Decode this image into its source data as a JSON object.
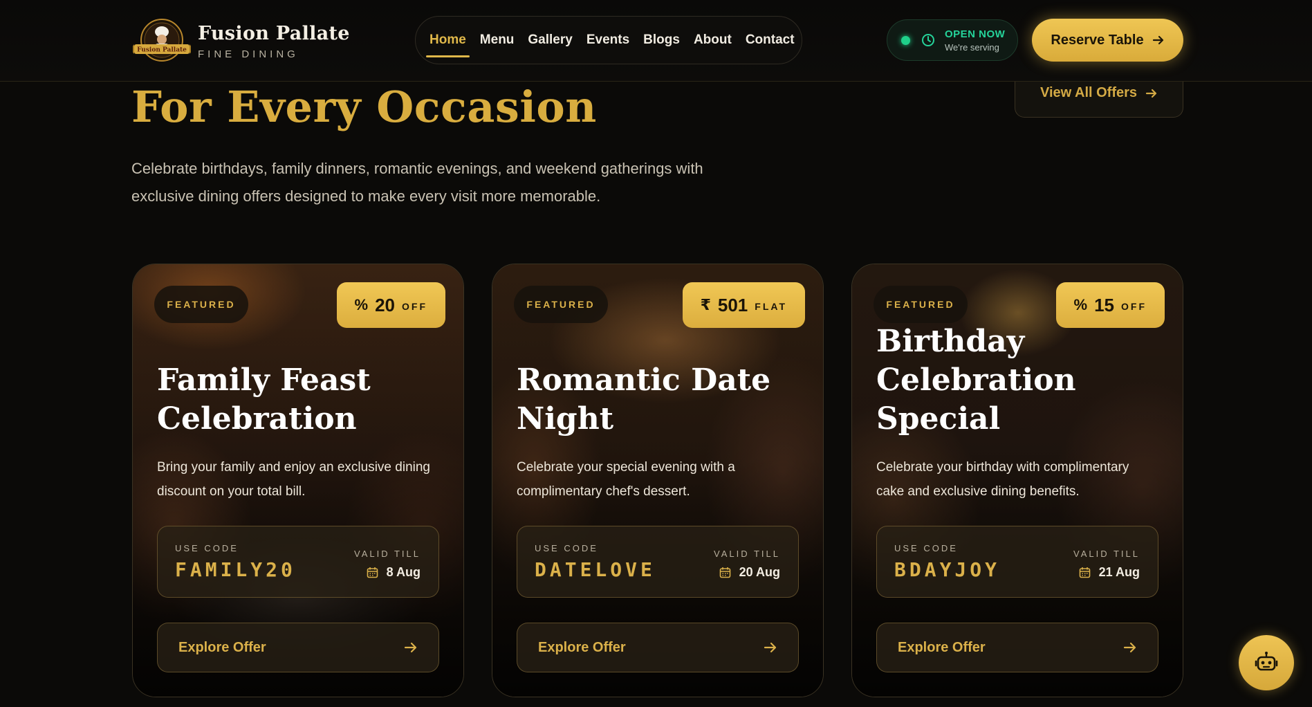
{
  "brand": {
    "name": "Fusion Pallate",
    "subtitle": "FINE DINING",
    "logo_text": "Fusion Pallate"
  },
  "nav": {
    "items": [
      {
        "label": "Home",
        "active": true
      },
      {
        "label": "Menu",
        "active": false
      },
      {
        "label": "Gallery",
        "active": false
      },
      {
        "label": "Events",
        "active": false
      },
      {
        "label": "Blogs",
        "active": false
      },
      {
        "label": "About",
        "active": false
      },
      {
        "label": "Contact",
        "active": false
      }
    ]
  },
  "status": {
    "title": "OPEN NOW",
    "subtitle": "We're serving",
    "dot_color": "#1fd08a",
    "icons": [
      "status-dot",
      "clock-icon"
    ]
  },
  "header": {
    "reserve_label": "Reserve Table",
    "reserve_icon": "arrow-right-icon"
  },
  "section": {
    "title": "For Every Occasion",
    "description": "Celebrate birthdays, family dinners, romantic evenings, and weekend gatherings with exclusive dining offers designed to make every visit more memorable.",
    "view_all_label": "View All Offers"
  },
  "cards": [
    {
      "tag": "FEATURED",
      "offer_icon": "%",
      "offer_value": "20",
      "offer_unit": "OFF",
      "title": "Family Feast Celebration",
      "description": "Bring your family and enjoy an exclusive dining discount on your total bill.",
      "code_label": "USE CODE",
      "code": "FAMILY20",
      "valid_label": "VALID TILL",
      "valid_date": "8 Aug",
      "cta": "Explore Offer"
    },
    {
      "tag": "FEATURED",
      "offer_icon": "₹",
      "offer_value": "501",
      "offer_unit": "FLAT",
      "title": "Romantic Date Night",
      "description": "Celebrate your special evening with a complimentary chef's dessert.",
      "code_label": "USE CODE",
      "code": "DATELOVE",
      "valid_label": "VALID TILL",
      "valid_date": "20 Aug",
      "cta": "Explore Offer"
    },
    {
      "tag": "FEATURED",
      "offer_icon": "%",
      "offer_value": "15",
      "offer_unit": "OFF",
      "title": "Birthday Celebration Special",
      "description": "Celebrate your birthday with complimentary cake and exclusive dining benefits.",
      "code_label": "USE CODE",
      "code": "BDAYJOY",
      "valid_label": "VALID TILL",
      "valid_date": "21 Aug",
      "cta": "Explore Offer"
    }
  ],
  "colors": {
    "accent_gold": "#e0b84a",
    "background": "#0b0a08",
    "open_green": "#25d39a"
  },
  "chatbot": {
    "icon": "robot-icon"
  }
}
